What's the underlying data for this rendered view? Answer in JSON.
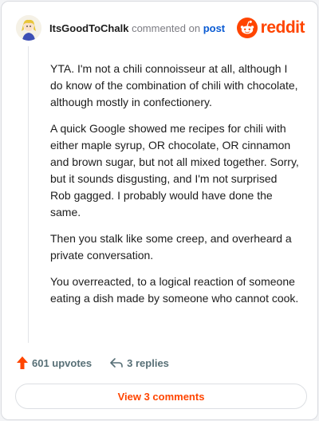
{
  "comment": {
    "username": "ItsGoodToChalk",
    "commented_text": "commented on",
    "post_link": "post",
    "paragraphs": [
      "YTA. I'm not a chili connoisseur at all, although I do know of the combination of chili with chocolate, although mostly in confectionery.",
      "A quick Google showed me recipes for chili with either maple syrup, OR chocolate, OR cinnamon and brown sugar, but not all mixed together. Sorry, but it sounds disgusting, and I'm not surprised Rob gagged. I probably would have done the same.",
      "Then you stalk like some creep, and overheard a private conversation.",
      "You overreacted, to a logical reaction of someone eating a dish made by someone who cannot cook."
    ]
  },
  "logo": {
    "wordmark": "reddit"
  },
  "actions": {
    "upvotes": "601 upvotes",
    "replies": "3 replies"
  },
  "view_comments": "View 3 comments",
  "colors": {
    "brand": "#ff4500",
    "link": "#0a5bd3",
    "muted": "#576f76"
  }
}
